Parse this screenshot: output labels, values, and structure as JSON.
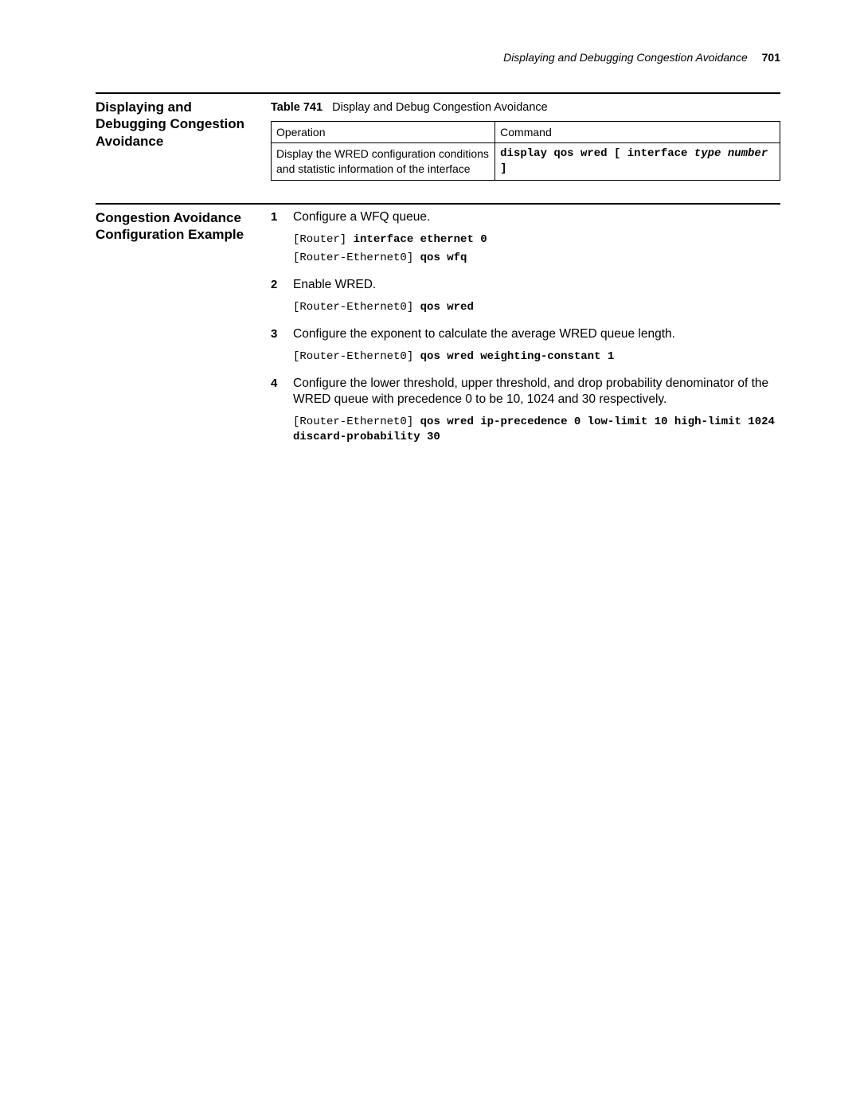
{
  "header": {
    "running_title": "Displaying and Debugging Congestion Avoidance",
    "page_number": "701"
  },
  "section1": {
    "heading": "Displaying and Debugging Congestion Avoidance",
    "table_label": "Table 741",
    "table_title": "Display and Debug Congestion Avoidance",
    "col_operation": "Operation",
    "col_command": "Command",
    "row1_operation": "Display the WRED configuration conditions and statistic information of the interface",
    "row1_cmd_pre": "display qos wred [ interface ",
    "row1_cmd_type": "type",
    "row1_cmd_br": " ",
    "row1_cmd_number": "number",
    "row1_cmd_post": " ]"
  },
  "section2": {
    "heading": "Congestion Avoidance Configuration Example",
    "steps": [
      {
        "text": "Configure a WFQ queue.",
        "code": [
          {
            "segments": [
              {
                "t": "[Router] ",
                "b": false
              },
              {
                "t": "interface ethernet 0",
                "b": true
              }
            ]
          },
          {
            "segments": [
              {
                "t": "[Router-Ethernet0] ",
                "b": false
              },
              {
                "t": "qos wfq",
                "b": true
              }
            ]
          }
        ]
      },
      {
        "text": "Enable WRED.",
        "code": [
          {
            "segments": [
              {
                "t": "[Router-Ethernet0] ",
                "b": false
              },
              {
                "t": "qos wred",
                "b": true
              }
            ]
          }
        ]
      },
      {
        "text": "Configure the exponent to calculate the average WRED queue length.",
        "code": [
          {
            "segments": [
              {
                "t": "[Router-Ethernet0] ",
                "b": false
              },
              {
                "t": "qos wred weighting-constant 1",
                "b": true
              }
            ]
          }
        ]
      },
      {
        "text": "Configure the lower threshold, upper threshold, and drop probability denominator of the WRED queue with precedence 0 to be 10, 1024 and 30 respectively.",
        "code": [
          {
            "segments": [
              {
                "t": "[Router-Ethernet0] ",
                "b": false
              },
              {
                "t": "qos wred ip-precedence 0 low-limit 10 high-limit 1024 discard-probability 30",
                "b": true
              }
            ]
          }
        ]
      }
    ]
  }
}
